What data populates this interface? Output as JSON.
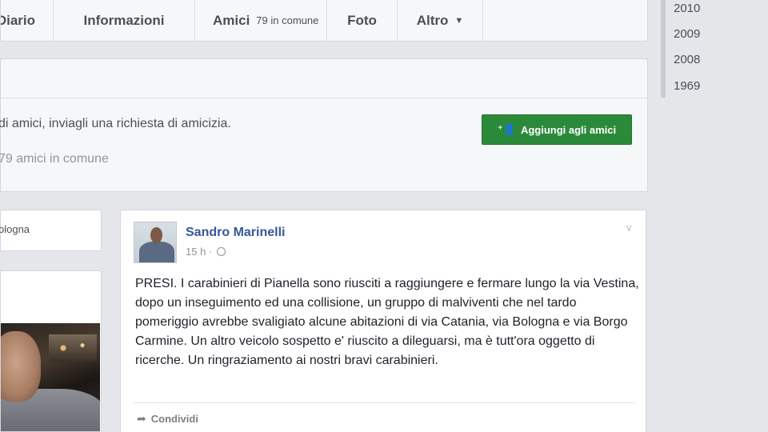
{
  "tabs": {
    "diario": "Diario",
    "informazioni": "Informazioni",
    "amici": "Amici",
    "amici_count": "79 in comune",
    "foto": "Foto",
    "altro": "Altro"
  },
  "friend_box": {
    "message": "Se conosci Sandro Marinelli e desideri vedere i contenuti che condivide con gli amici, inviagli una richiesta di amicizia.",
    "message_visible": "di amici, inviagli una richiesta di amicizia.",
    "mutual": "79 amici in comune",
    "add_button": "Aggiungi agli amici"
  },
  "left_column": {
    "location_snippet": "ologna"
  },
  "post": {
    "author": "Sandro Marinelli",
    "time": "15 h",
    "text": "PRESI. I carabinieri di Pianella sono riusciti a raggiungere e fermare lungo la via Vestina, dopo un inseguimento ed una collisione, un gruppo di malviventi che nel tardo pomeriggio avrebbe svaligiato alcune abitazioni di via Catania, via Bologna e via Borgo Carmine. Un altro veicolo sospetto e' riuscito a dileguarsi, ma è tutt'ora oggetto di ricerche. Un ringraziamento ai nostri bravi carabinieri.",
    "share": "Condividi"
  },
  "years": [
    "2010",
    "2009",
    "2008",
    "1969"
  ],
  "colors": {
    "brand_link": "#365899",
    "add_button": "#2b8a3a",
    "page_bg": "#e4e6ea"
  }
}
